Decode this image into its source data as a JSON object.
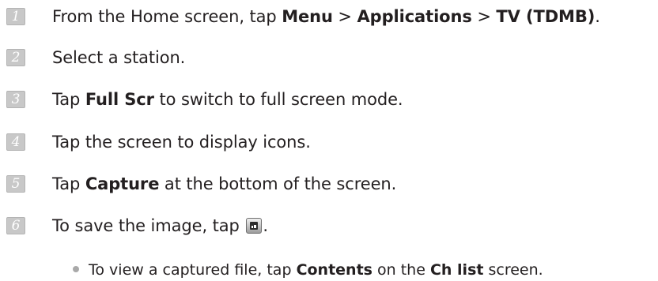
{
  "steps": [
    {
      "number": "1",
      "parts": [
        "From the Home screen, tap ",
        "Menu",
        " > ",
        "Applications",
        " > ",
        "TV (TDMB)",
        "."
      ]
    },
    {
      "number": "2",
      "text": "Select a station."
    },
    {
      "number": "3",
      "parts": [
        "Tap ",
        "Full Scr",
        " to switch to full screen mode."
      ]
    },
    {
      "number": "4",
      "text": "Tap the screen to display icons."
    },
    {
      "number": "5",
      "parts": [
        "Tap ",
        "Capture",
        " at the bottom of the screen."
      ]
    },
    {
      "number": "6",
      "parts": [
        "To save the image, tap ",
        "."
      ],
      "icon": "save-image-icon"
    }
  ],
  "note": {
    "parts": [
      "To view a captured file, tap ",
      "Contents",
      " on the ",
      "Ch list",
      " screen."
    ]
  },
  "colors": {
    "text": "#231f20",
    "step_badge": "#c8c8c8",
    "bullet": "#a9a9a9"
  }
}
